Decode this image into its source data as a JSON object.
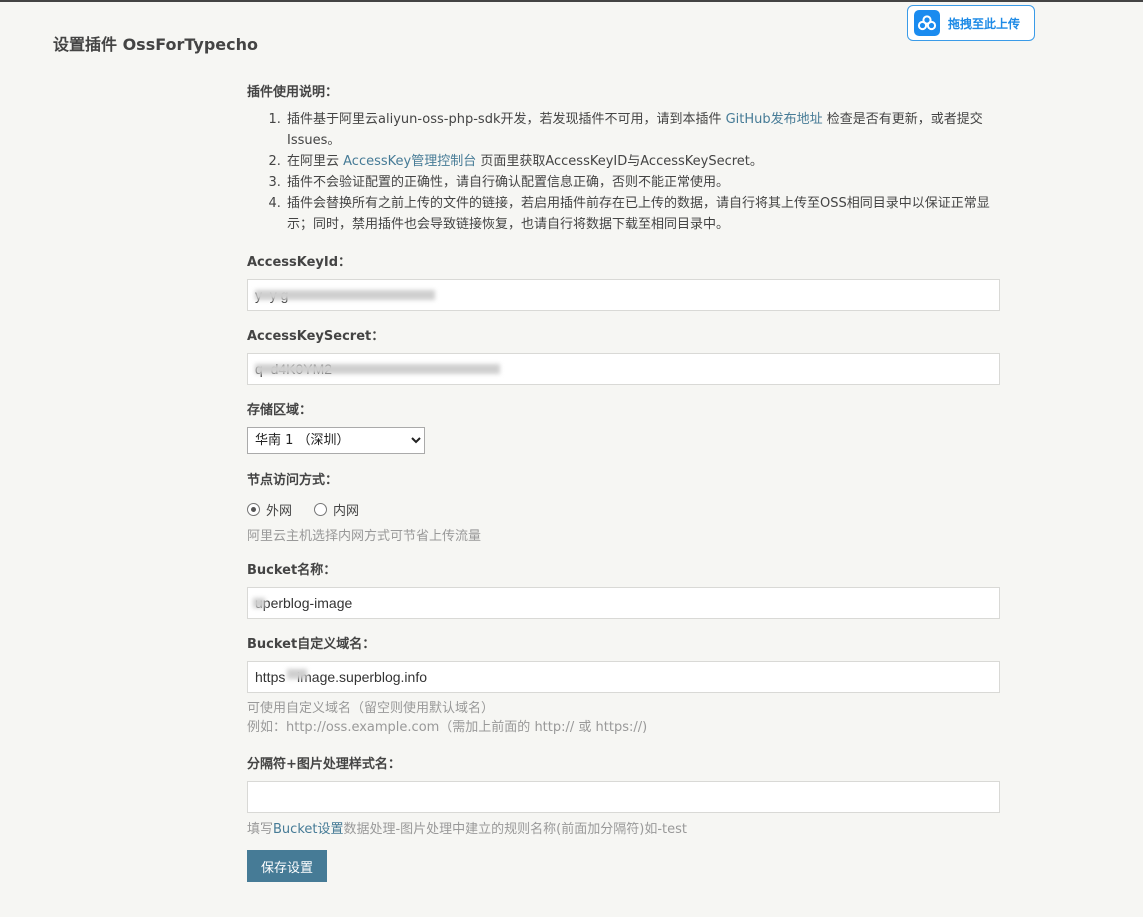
{
  "page": {
    "title": "设置插件 OssForTypecho"
  },
  "upload_button": {
    "label": "拖拽至此上传"
  },
  "instructions": {
    "heading": "插件使用说明：",
    "items": [
      {
        "before": "插件基于阿里云aliyun-oss-php-sdk开发，若发现插件不可用，请到本插件 ",
        "link": "GitHub发布地址",
        "after": " 检查是否有更新，或者提交Issues。"
      },
      {
        "before": "在阿里云 ",
        "link": "AccessKey管理控制台",
        "after": " 页面里获取AccessKeyID与AccessKeySecret。"
      },
      {
        "before": "插件不会验证配置的正确性，请自行确认配置信息正确，否则不能正常使用。",
        "link": "",
        "after": ""
      },
      {
        "before": "插件会替换所有之前上传的文件的链接，若启用插件前存在已上传的数据，请自行将其上传至OSS相同目录中以保证正常显示；同时，禁用插件也会导致链接恢复，也请自行将数据下载至相同目录中。",
        "link": "",
        "after": ""
      }
    ]
  },
  "access_key_id": {
    "label": "AccessKeyId：",
    "value": "y  y g"
  },
  "access_key_secret": {
    "label": "AccessKeySecret：",
    "value": "q  d4K0YM2"
  },
  "region": {
    "label": "存储区域：",
    "selected": "华南 1 （深圳）"
  },
  "endpoint": {
    "label": "节点访问方式：",
    "options": [
      {
        "label": "外网",
        "checked": true
      },
      {
        "label": "内网",
        "checked": false
      }
    ],
    "description": "阿里云主机选择内网方式可节省上传流量"
  },
  "bucket_name": {
    "label": "Bucket名称：",
    "value": "uperblog-image"
  },
  "bucket_domain": {
    "label": "Bucket自定义域名：",
    "value": "https   image.superblog.info",
    "description_line1": "可使用自定义域名（留空则使用默认域名）",
    "description_line2": "例如：http://oss.example.com（需加上前面的 http:// 或 https://)"
  },
  "style_name": {
    "label": "分隔符+图片处理样式名：",
    "value": "",
    "description_before": "填写",
    "description_link": "Bucket设置",
    "description_after": "数据处理-图片处理中建立的规则名称(前面加分隔符)如-test"
  },
  "save_button": {
    "label": "保存设置"
  }
}
